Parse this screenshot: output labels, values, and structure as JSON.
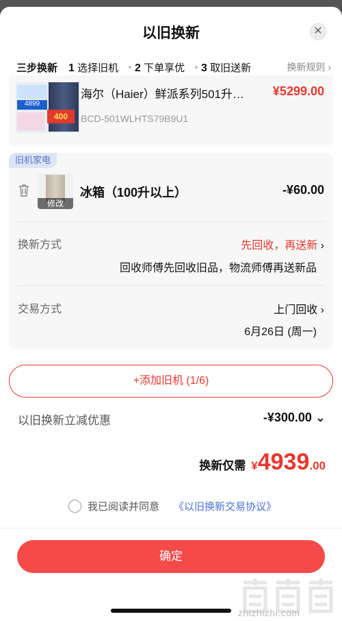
{
  "header": {
    "title": "以旧换新",
    "close_icon": "close-icon"
  },
  "steps": {
    "label": "三步换新",
    "items": [
      {
        "num": "1",
        "label": "选择旧机"
      },
      {
        "num": "2",
        "label": "下单享优"
      },
      {
        "num": "3",
        "label": "取旧送新"
      }
    ],
    "rules_link": "换新规则",
    "rules_icon": "chevron-right-icon"
  },
  "product": {
    "name": "海尔（Haier）鲜派系列501升…",
    "price": "¥5299.00",
    "model": "BCD-501WLHTS79B9U1",
    "image_badge_top": "4899",
    "image_badge_red": "400"
  },
  "old_appliance": {
    "tag": "旧机家电",
    "name": "冰箱（100升以上）",
    "price": "-¥60.00",
    "edit_label": "修改",
    "trash_icon": "trash-icon"
  },
  "exchange_method": {
    "label": "换新方式",
    "value": "先回收，再送新",
    "description": "回收师傅先回收旧品，物流师傅再送新品"
  },
  "trade_method": {
    "label": "交易方式",
    "value": "上门回收",
    "date": "6月26日 (周一)"
  },
  "add_button": "+添加旧机 (1/6)",
  "discount": {
    "label": "以旧换新立减优惠",
    "value": "-¥300.00"
  },
  "total": {
    "label": "换新仅需",
    "currency": "¥",
    "integer": "4939",
    "decimal": ".00"
  },
  "agreement": {
    "text": "我已阅读并同意",
    "link": "《以旧换新交易协议》"
  },
  "confirm_button": "确定",
  "watermark": "zhizhizhi.com",
  "colors": {
    "accent": "#e8382e",
    "confirm_bg": "#f44a4a",
    "link": "#4a6fd8",
    "tag_bg": "#dde4f5"
  }
}
